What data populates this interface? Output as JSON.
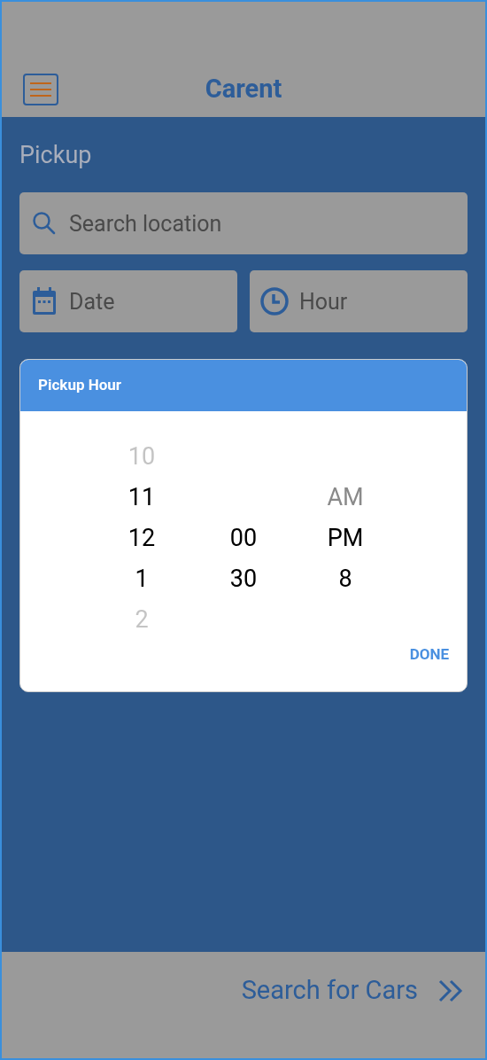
{
  "app_bar": {
    "title": "Carent"
  },
  "pickup": {
    "heading": "Pickup",
    "location_field": {
      "placeholder": "Search location"
    },
    "date_field": {
      "placeholder": "Date"
    },
    "hour_field": {
      "placeholder": "Hour"
    }
  },
  "dialog": {
    "title": "Pickup Hour",
    "rows": [
      {
        "hour": {
          "text": "10",
          "kind": "faded"
        }
      },
      {
        "hour": {
          "text": "11",
          "kind": "plain"
        },
        "period": {
          "text": "AM",
          "kind": "dim"
        }
      },
      {
        "hour": {
          "text": "12",
          "kind": "plain"
        },
        "minute": {
          "text": "00",
          "kind": "plain"
        },
        "period": {
          "text": "PM",
          "kind": "plain"
        }
      },
      {
        "hour": {
          "text": "1",
          "kind": "plain"
        },
        "minute": {
          "text": "30",
          "kind": "plain"
        },
        "period": {
          "text": "8",
          "kind": "plain"
        }
      },
      {
        "hour": {
          "text": "2",
          "kind": "faded"
        }
      }
    ],
    "done_button": "DONE"
  },
  "footer": {
    "search_button": "Search for Cars"
  }
}
